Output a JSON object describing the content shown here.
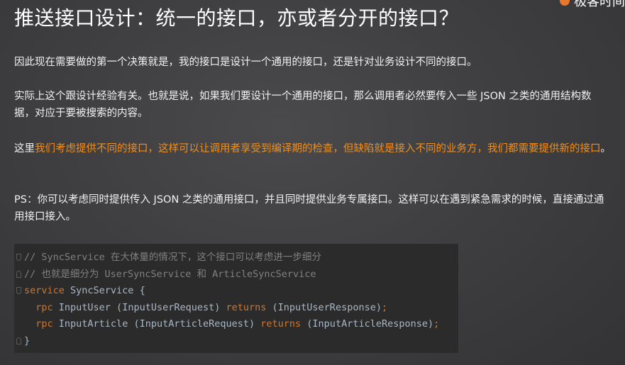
{
  "header": {
    "title": "推送接口设计：统一的接口，亦或者分开的接口？",
    "logo_text": "极客时间"
  },
  "paragraphs": {
    "p1": "因此现在需要做的第一个决策就是，我的接口是设计一个通用的接口，还是针对业务设计不同的接口。",
    "p2": "实际上这个跟设计经验有关。也就是说，如果我们要设计一个通用的接口，那么调用者必然要传入一些 JSON 之类的通用结构数据，对应于要被搜索的内容。",
    "p3_prefix": "这里",
    "p3_highlight": "我们考虑提供不同的接口，这样可以让调用者享受到编译期的检查，但缺陷就是接入不同的业务方，我们都需要提供新的接口",
    "p3_suffix": "。",
    "p4": "PS：你可以考虑同时提供传入 JSON 之类的通用接口，并且同时提供业务专属接口。这样可以在遇到紧急需求的时候，直接通过通用接口接入。"
  },
  "code": {
    "line1_comment": "// SyncService 在大体量的情况下，这个接口可以考虑进一步细分",
    "line2_comment": "// 也就是细分为 UserSyncService 和 ArticleSyncService",
    "line3_keyword": "service",
    "line3_rest": " SyncService {",
    "line4_indent": "  ",
    "line4_rpc": "rpc",
    "line4_name": " InputUser (InputUserRequest) ",
    "line4_returns": "returns",
    "line4_resp": " (InputUserResponse)",
    "line4_semi": ";",
    "line5_indent": "  ",
    "line5_rpc": "rpc",
    "line5_name": " InputArticle (InputArticleRequest) ",
    "line5_returns": "returns",
    "line5_resp": " (InputArticleResponse)",
    "line5_semi": ";",
    "line6_close": "}"
  },
  "colors": {
    "highlight": "#ef8f1f",
    "code_background": "#2b2b2b",
    "keyword": "#cc7832",
    "comment": "#808080"
  }
}
